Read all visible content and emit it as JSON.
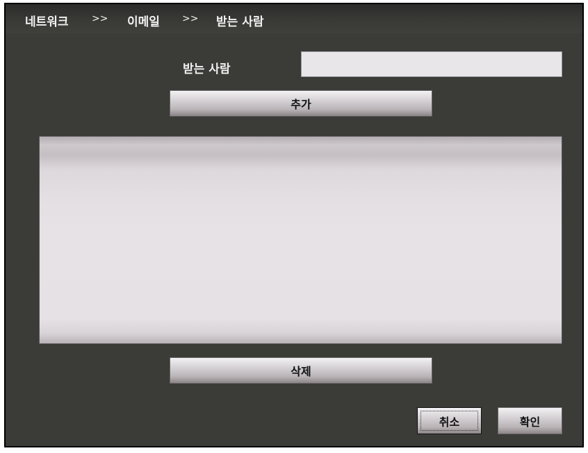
{
  "breadcrumb": {
    "items": [
      "네트워크",
      "이메일",
      "받는 사람"
    ],
    "separator": ">>"
  },
  "recipient": {
    "label": "받는 사람",
    "value": "",
    "placeholder": ""
  },
  "buttons": {
    "add_label": "추가",
    "delete_label": "삭제",
    "cancel_label": "취소",
    "ok_label": "확인"
  },
  "recipient_list": {
    "items": []
  },
  "colors": {
    "window_bg": "#3b3b38",
    "text": "#f2f2f2",
    "input_bg": "#e8e6e9",
    "list_bg": "#e6e1e5"
  }
}
